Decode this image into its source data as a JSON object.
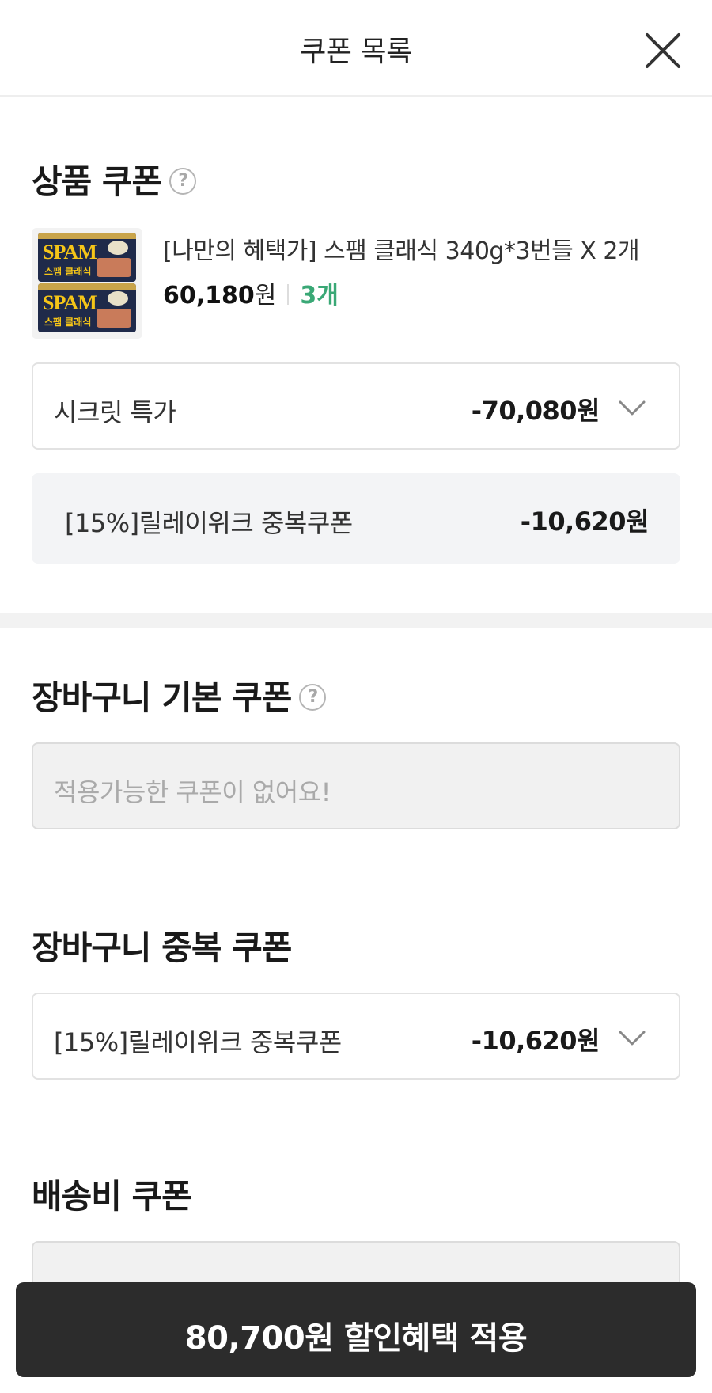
{
  "header": {
    "title": "쿠폰 목록",
    "close_icon": "close-icon"
  },
  "product_coupon": {
    "title": "상품 쿠폰",
    "help": "?",
    "product": {
      "name": "[나만의 혜택가] 스팸 클래식 340g*3번들 X 2개",
      "price": "60,180",
      "currency": "원",
      "quantity": "3개",
      "image_brand": "SPAM",
      "image_sub": "스팸 클래식"
    },
    "selected_coupon": {
      "name": "시크릿 특가",
      "amount": "-70,080원"
    },
    "stacked_coupon": {
      "name": "[15%]릴레이위크 중복쿠폰",
      "amount": "-10,620원"
    }
  },
  "cart_basic_coupon": {
    "title": "장바구니 기본 쿠폰",
    "help": "?",
    "empty_text": "적용가능한 쿠폰이 없어요!"
  },
  "cart_stack_coupon": {
    "title": "장바구니 중복 쿠폰",
    "selected_coupon": {
      "name": "[15%]릴레이위크 중복쿠폰",
      "amount": "-10,620원"
    }
  },
  "shipping_coupon": {
    "title": "배송비 쿠폰"
  },
  "footer": {
    "apply_label": "80,700원 할인혜택 적용"
  },
  "colors": {
    "accent_quantity": "#3aa876",
    "button_bg": "#2c2c2c"
  }
}
